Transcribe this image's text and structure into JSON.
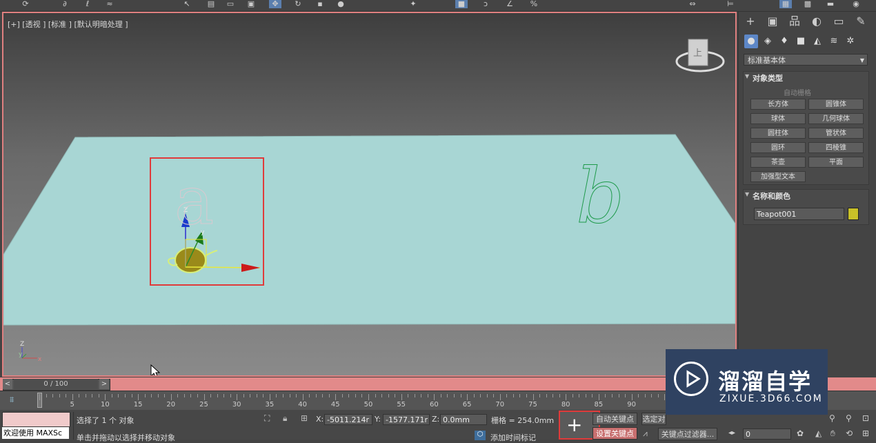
{
  "viewport": {
    "label": "[+] [透视 ] [标准 ] [默认明暗处理 ]",
    "text_a": "a",
    "text_b": "b",
    "axis_z": "Z",
    "axis_y": "y",
    "axis_x": "x",
    "gizmo_y": "y"
  },
  "timeline": {
    "frame_display": "0 / 100",
    "prev_label": "<",
    "next_label": ">",
    "ticks": [
      "5",
      "10",
      "15",
      "20",
      "25",
      "30",
      "35",
      "40",
      "45",
      "50",
      "55",
      "60",
      "65",
      "70",
      "75",
      "80",
      "85",
      "90"
    ]
  },
  "status": {
    "maxscript_label": "欢迎使用 MAXSc",
    "selection_text": "选择了 1 个 对象",
    "prompt_text": "单击并拖动以选择并移动对象",
    "x_label": "X:",
    "x_value": "-5011.214r",
    "y_label": "Y:",
    "y_value": "-1577.171r",
    "z_label": "Z:",
    "z_value": "0.0mm",
    "grid_text": "栅格 = 254.0mm",
    "add_time_tag": "添加时间标记",
    "auto_key": "自动关键点",
    "set_key": "设置关键点",
    "selected_obj": "选定对",
    "key_filters": "关键点过滤器...",
    "frame_value": "0"
  },
  "panel": {
    "dropdown": "标准基本体",
    "object_type_header": "对象类型",
    "autogrid": "自动栅格",
    "buttons": [
      "长方体",
      "圆锥体",
      "球体",
      "几何球体",
      "圆柱体",
      "管状体",
      "圆环",
      "四棱锥",
      "茶壶",
      "平面",
      "加强型文本"
    ],
    "name_color_header": "名称和颜色",
    "object_name": "Teapot001",
    "object_color": "#c8c028"
  },
  "watermark": {
    "title": "溜溜自学",
    "subtitle": "ZIXUE.3D66.COM"
  },
  "colors": {
    "selection_box": "#e03a3a",
    "plane": "#a8d6d4",
    "time_bar": "#e28a8a"
  }
}
